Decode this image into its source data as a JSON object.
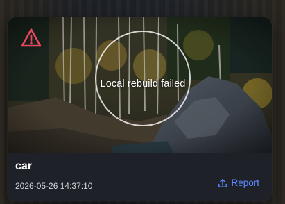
{
  "card": {
    "status_text": "Local rebuild failed",
    "title": "car",
    "timestamp": "2026-05-26 14:37:10",
    "report_label": "Report"
  },
  "icons": {
    "warning": "warning-triangle-icon",
    "report": "upload-icon"
  },
  "colors": {
    "warning": "#e8475f",
    "accent": "#5b8cff",
    "card_bg": "#1f2128"
  }
}
